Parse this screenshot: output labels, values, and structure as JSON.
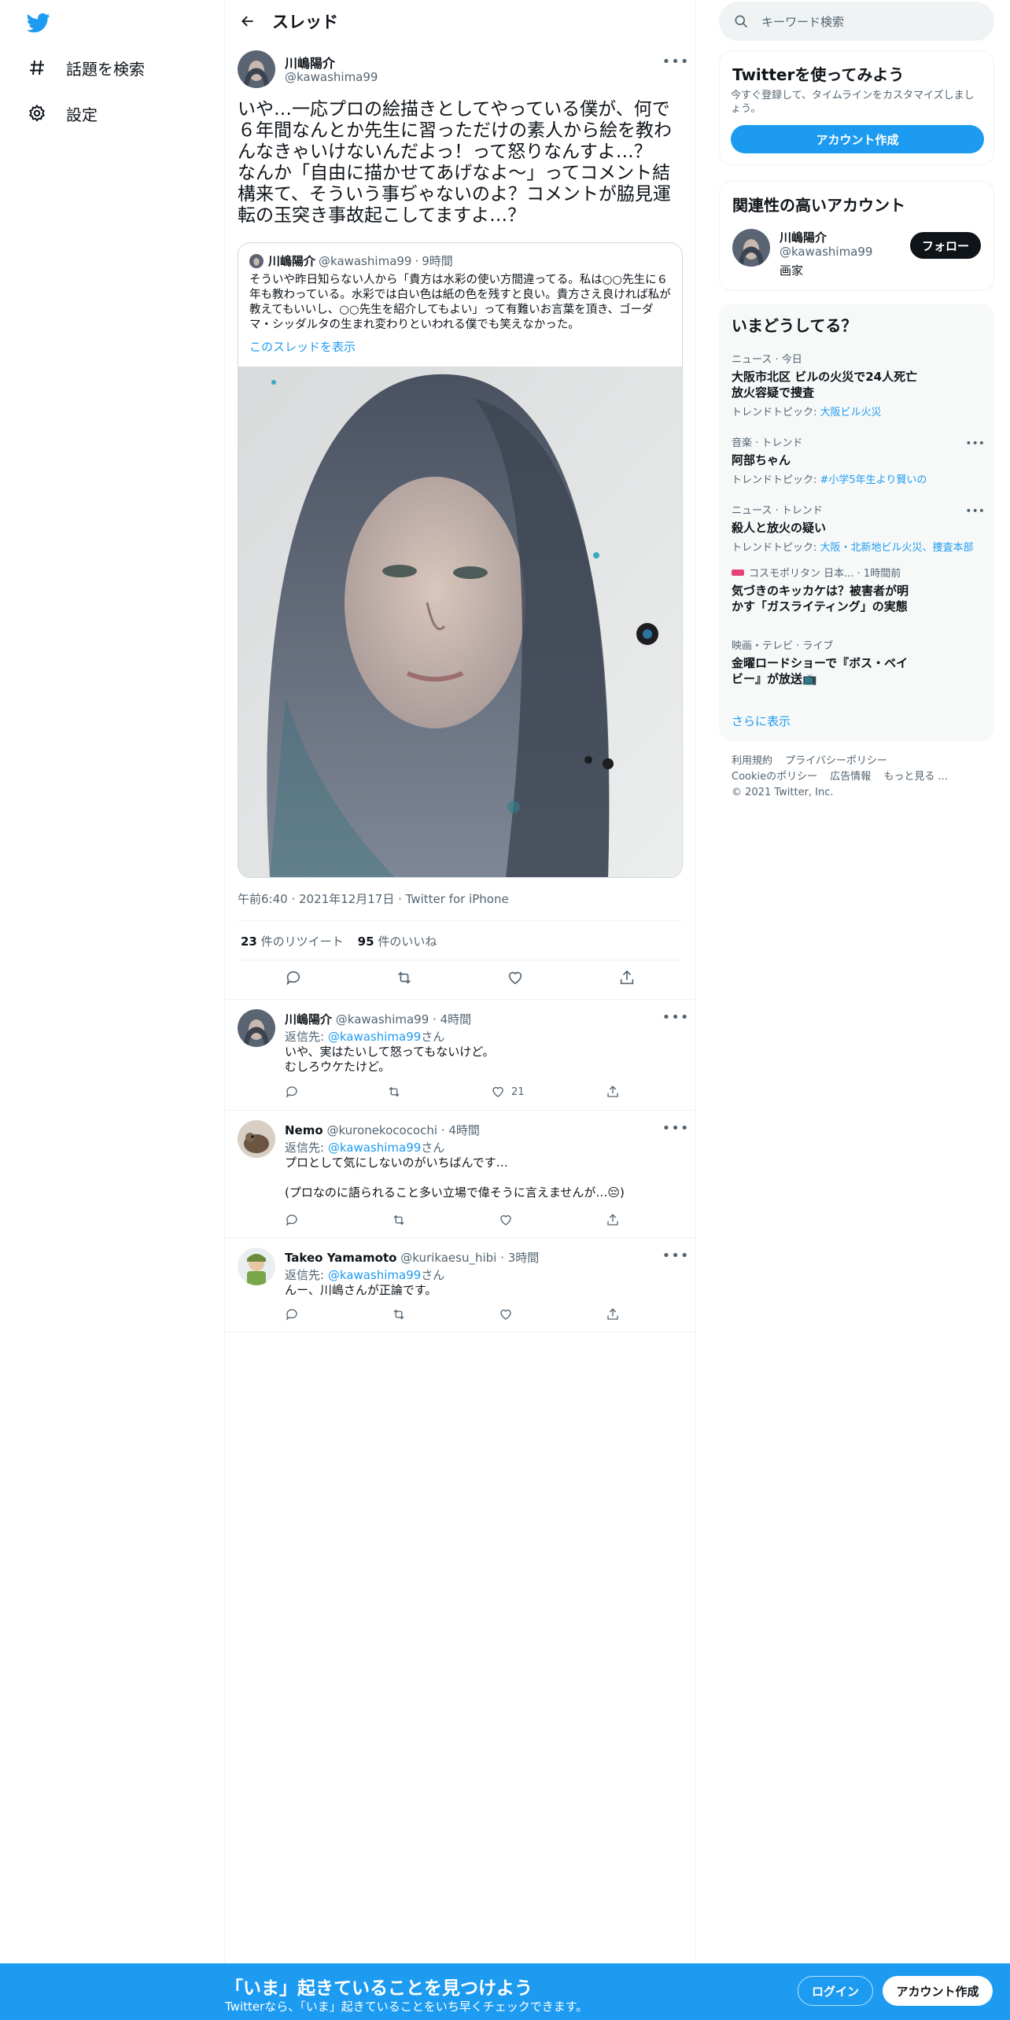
{
  "colors": {
    "accent": "#1d9bf0",
    "text": "#0f1419",
    "muted": "#536471",
    "border": "#eff3f4"
  },
  "nav": {
    "items": [
      {
        "label": "話題を検索",
        "icon": "hashtag-icon"
      },
      {
        "label": "設定",
        "icon": "gear-icon"
      }
    ]
  },
  "header": {
    "title": "スレッド"
  },
  "tweet": {
    "author_name": "川嶋陽介",
    "author_handle": "@kawashima99",
    "text": "いや…一応プロの絵描きとしてやっている僕が、何で６年間なんとか先生に習っただけの素人から絵を教わんなきゃいけないんだよっ！って怒りなんすよ…？\nなんか「自由に描かせてあげなよ〜」ってコメント結構来て、そういう事ぢゃないのよ？コメントが脇見運転の玉突き事故起こしてますよ…？",
    "quote": {
      "author_name": "川嶋陽介",
      "author_handle": "@kawashima99",
      "time": "9時間",
      "text": "そういや昨日知らない人から「貴方は水彩の使い方間違ってる。私は○○先生に６年も教わっている。水彩では白い色は紙の色を残すと良い。貴方さえ良ければ私が教えてもいいし、○○先生を紹介してもよい」って有難いお言葉を頂き、ゴーダマ・シッダルタの生まれ変わりといわれる僕でも笑えなかった。",
      "show_thread": "このスレッドを表示"
    },
    "timestamp": "午前6:40 · 2021年12月17日 · Twitter for iPhone",
    "retweets": "23",
    "retweets_label": "件のリツイート",
    "likes": "95",
    "likes_label": "件のいいね"
  },
  "replies": [
    {
      "name": "川嶋陽介",
      "handle": "@kawashima99",
      "time": "4時間",
      "reply_to_prefix": "返信先: ",
      "reply_to_handle": "@kawashima99",
      "reply_to_suffix": "さん",
      "text": "いや、実はたいして怒ってもないけど。\nむしろウケたけど。",
      "like_count": "21"
    },
    {
      "name": "Nemo",
      "handle": "@kuronekococochi",
      "time": "4時間",
      "reply_to_prefix": "返信先: ",
      "reply_to_handle": "@kawashima99",
      "reply_to_suffix": "さん",
      "text": "プロとして気にしないのがいちばんです…\n\n(プロなのに語られること多い立場で偉そうに言えませんが…😔)",
      "like_count": ""
    },
    {
      "name": "Takeo Yamamoto",
      "handle": "@kurikaesu_hibi",
      "time": "3時間",
      "reply_to_prefix": "返信先: ",
      "reply_to_handle": "@kawashima99",
      "reply_to_suffix": "さん",
      "text": "んー、川嶋さんが正論です。",
      "like_count": ""
    }
  ],
  "search": {
    "placeholder": "キーワード検索"
  },
  "signup_card": {
    "title": "Twitterを使ってみよう",
    "subtitle": "今すぐ登録して、タイムラインをカスタマイズしましょう。",
    "button": "アカウント作成"
  },
  "related": {
    "title": "関連性の高いアカウント",
    "name": "川嶋陽介",
    "handle": "@kawashima99",
    "bio": "画家",
    "follow": "フォロー"
  },
  "trends": {
    "title": "いまどうしてる？",
    "items": [
      {
        "context": "ニュース · 今日",
        "title": "大阪市北区 ビルの火災で24人死亡\n放火容疑で捜査",
        "topic_label": "トレンドトピック: ",
        "topic": "大阪ビル火災"
      },
      {
        "context": "音楽 · トレンド",
        "title": "阿部ちゃん",
        "topic_label": "トレンドトピック: ",
        "topic": "#小学5年生より賢いの"
      },
      {
        "context": "ニュース · トレンド",
        "title": "殺人と放火の疑い",
        "topic_label": "トレンドトピック: ",
        "topic": "大阪・北新地ビル火災、捜査本部"
      },
      {
        "context": "コスモポリタン 日本... · 1時間前",
        "title": "気づきのキッカケは？被害者が明\nかす「ガスライティング」の実態",
        "topic_label": "",
        "topic": ""
      },
      {
        "context": "映画・テレビ · ライブ",
        "title": "金曜ロードショーで『ボス・ベイ\nビー』が放送📺",
        "topic_label": "",
        "topic": ""
      }
    ],
    "show_more": "さらに表示"
  },
  "footer": {
    "links": [
      "利用規約",
      "プライバシーポリシー",
      "Cookieのポリシー",
      "広告情報",
      "もっと見る ..."
    ],
    "copyright": "© 2021 Twitter, Inc."
  },
  "banner": {
    "title": "「いま」起きていることを見つけよう",
    "subtitle": "Twitterなら、「いま」起きていることをいち早くチェックできます。",
    "login": "ログイン",
    "signup": "アカウント作成"
  }
}
